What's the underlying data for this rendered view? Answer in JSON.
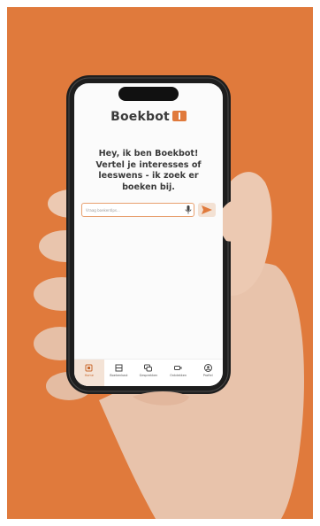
{
  "app": {
    "brand_name": "Boekbot",
    "greeting": "Hey, ik ben Boekbot! Vertel je interesses of leeswens - ik zoek er boeken bij.",
    "search_placeholder": "Vraag boekentips...",
    "nav": [
      {
        "label": "Home",
        "icon": "home-icon",
        "active": true
      },
      {
        "label": "Boekenkast",
        "icon": "bookshelf-icon",
        "active": false
      },
      {
        "label": "Gesprekken",
        "icon": "chat-icon",
        "active": false
      },
      {
        "label": "Ontdekken",
        "icon": "discover-icon",
        "active": false
      },
      {
        "label": "Profiel",
        "icon": "profile-icon",
        "active": false
      }
    ]
  },
  "colors": {
    "background": "#e07a3c",
    "accent": "#e07a3c",
    "skin": "#eccab4",
    "phone": "#1e1e1e"
  }
}
